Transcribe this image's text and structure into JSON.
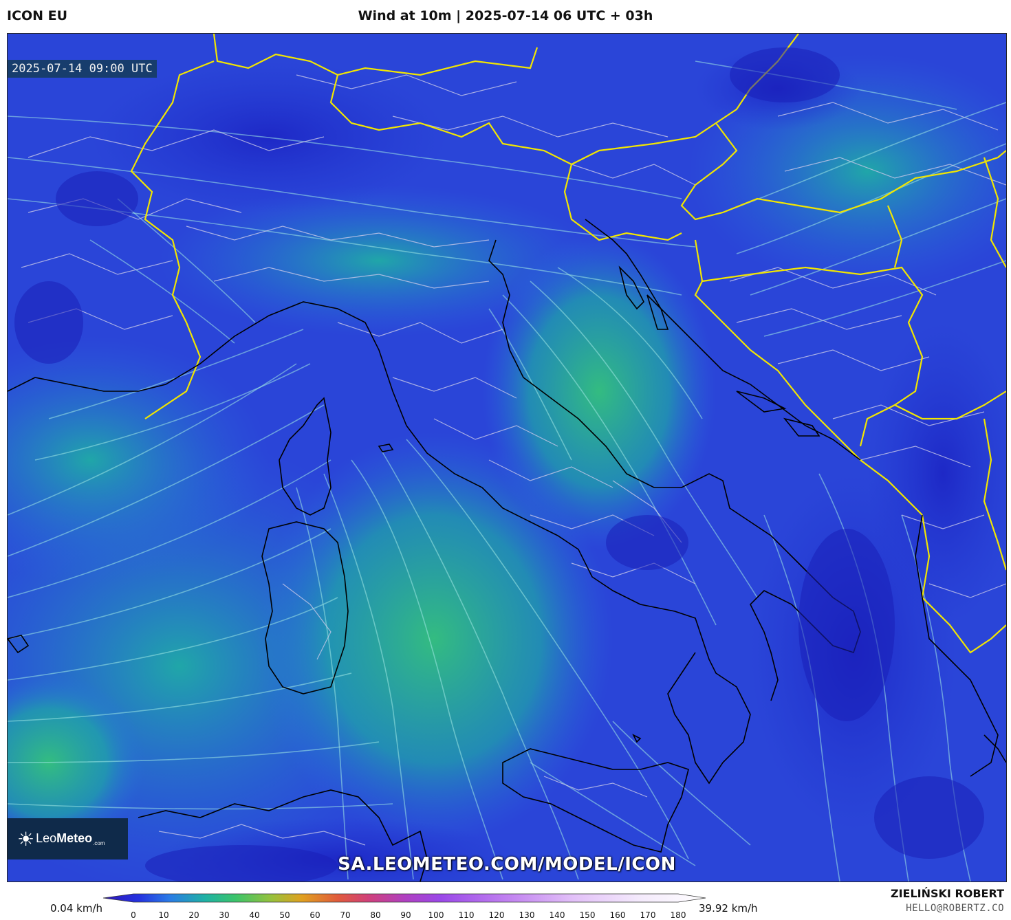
{
  "header": {
    "model": "ICON EU",
    "title": "Wind at 10m | 2025-07-14 06 UTC + 03h"
  },
  "map": {
    "valid_time": "2025-07-14 09:00 UTC",
    "logo_text_light": "Leo",
    "logo_text_bold": "Meteo",
    "logo_suffix": ".com",
    "url": "SA.LEOMETEO.COM/MODEL/ICON",
    "colors": {
      "calm": "#2b2fd0",
      "light": "#2a6fe0",
      "moderate": "#1fb39a",
      "fresh": "#35c27a",
      "borders_country": "#f2e600",
      "borders_region": "#c8c8e8",
      "coast": "#000000",
      "streamline": "#9fe8e4"
    }
  },
  "colorbar": {
    "min_label": "0.04 km/h",
    "max_label": "39.92 km/h",
    "ticks": [
      "0",
      "10",
      "20",
      "30",
      "40",
      "50",
      "60",
      "70",
      "80",
      "90",
      "100",
      "110",
      "120",
      "130",
      "140",
      "150",
      "160",
      "170",
      "180"
    ]
  },
  "credit": {
    "author": "ZIELIŃSKI ROBERT",
    "email": "HELLO@ROBERTZ.CO"
  }
}
